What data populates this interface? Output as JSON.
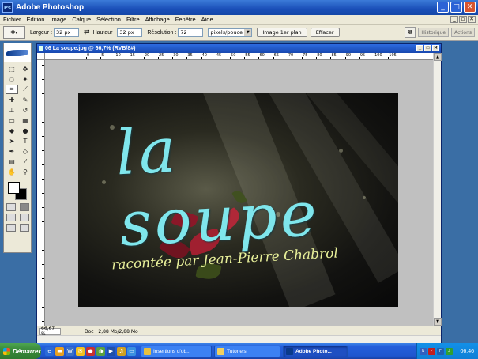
{
  "window": {
    "app_icon": "Ps",
    "title": "Adobe Photoshop",
    "buttons": {
      "minimize": "_",
      "maximize": "□",
      "close": "✕"
    }
  },
  "menu": [
    "Fichier",
    "Edition",
    "Image",
    "Calque",
    "Sélection",
    "Filtre",
    "Affichage",
    "Fenêtre",
    "Aide"
  ],
  "options": {
    "width_label": "Largeur :",
    "width_value": "32 px",
    "height_label": "Hauteur :",
    "height_value": "32 px",
    "resolution_label": "Résolution :",
    "resolution_value": "72",
    "unit_value": "pixels/pouce",
    "front_image_button": "Image 1er plan",
    "clear_button": "Effacer",
    "tab_history": "Historique",
    "tab_actions": "Actions"
  },
  "document": {
    "title": "06 La soupe.jpg @ 66,7% (RVB/8#)",
    "zoom": "66,67 %",
    "doc_info": "Doc : 2,88 Mo/2,88 Mo",
    "ruler_ticks": [
      "0",
      "5",
      "10",
      "15",
      "20",
      "25",
      "30",
      "35",
      "40",
      "45",
      "50",
      "55",
      "60",
      "65",
      "70",
      "75",
      "80",
      "85",
      "90",
      "95",
      "100",
      "105"
    ],
    "image_title": "la soupe",
    "image_subtitle": "racontée par Jean-Pierre Chabrol"
  },
  "taskbar": {
    "start": "Démarrer",
    "tasks": [
      {
        "label": "Insertions d'ob...",
        "icon_color": "#e8c040"
      },
      {
        "label": "Tutoriels",
        "icon_color": "#f0d060"
      },
      {
        "label": "Adobe Photo...",
        "icon_color": "#0a3a8a"
      }
    ],
    "clock": "06:46"
  },
  "colors": {
    "accent": "#245edb",
    "title_cyan": "#7fe6ec",
    "subtitle_yellow": "#e8f09a"
  }
}
